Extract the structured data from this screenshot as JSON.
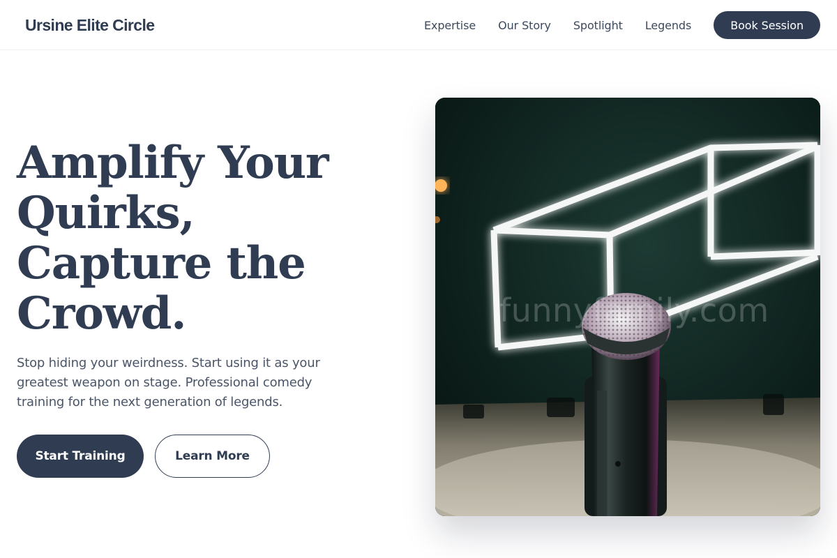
{
  "header": {
    "brand": "Ursine Elite Circle",
    "nav": [
      {
        "label": "Expertise"
      },
      {
        "label": "Our Story"
      },
      {
        "label": "Spotlight"
      },
      {
        "label": "Legends"
      }
    ],
    "cta_label": "Book Session"
  },
  "hero": {
    "title_lines": [
      "Amplify Your",
      "Quirks,",
      "Capture the",
      "Crowd."
    ],
    "subtitle": "Stop hiding your weirdness. Start using it as your greatest weapon on stage. Professional comedy training for the next generation of legends.",
    "primary_label": "Start Training",
    "secondary_label": "Learn More",
    "image": {
      "subject": "microphone-with-neon-cube",
      "watermark": "funnyfamily.com"
    }
  },
  "colors": {
    "primary": "#2f3c51",
    "background": "#ffffff",
    "text_muted": "#4a5568"
  }
}
